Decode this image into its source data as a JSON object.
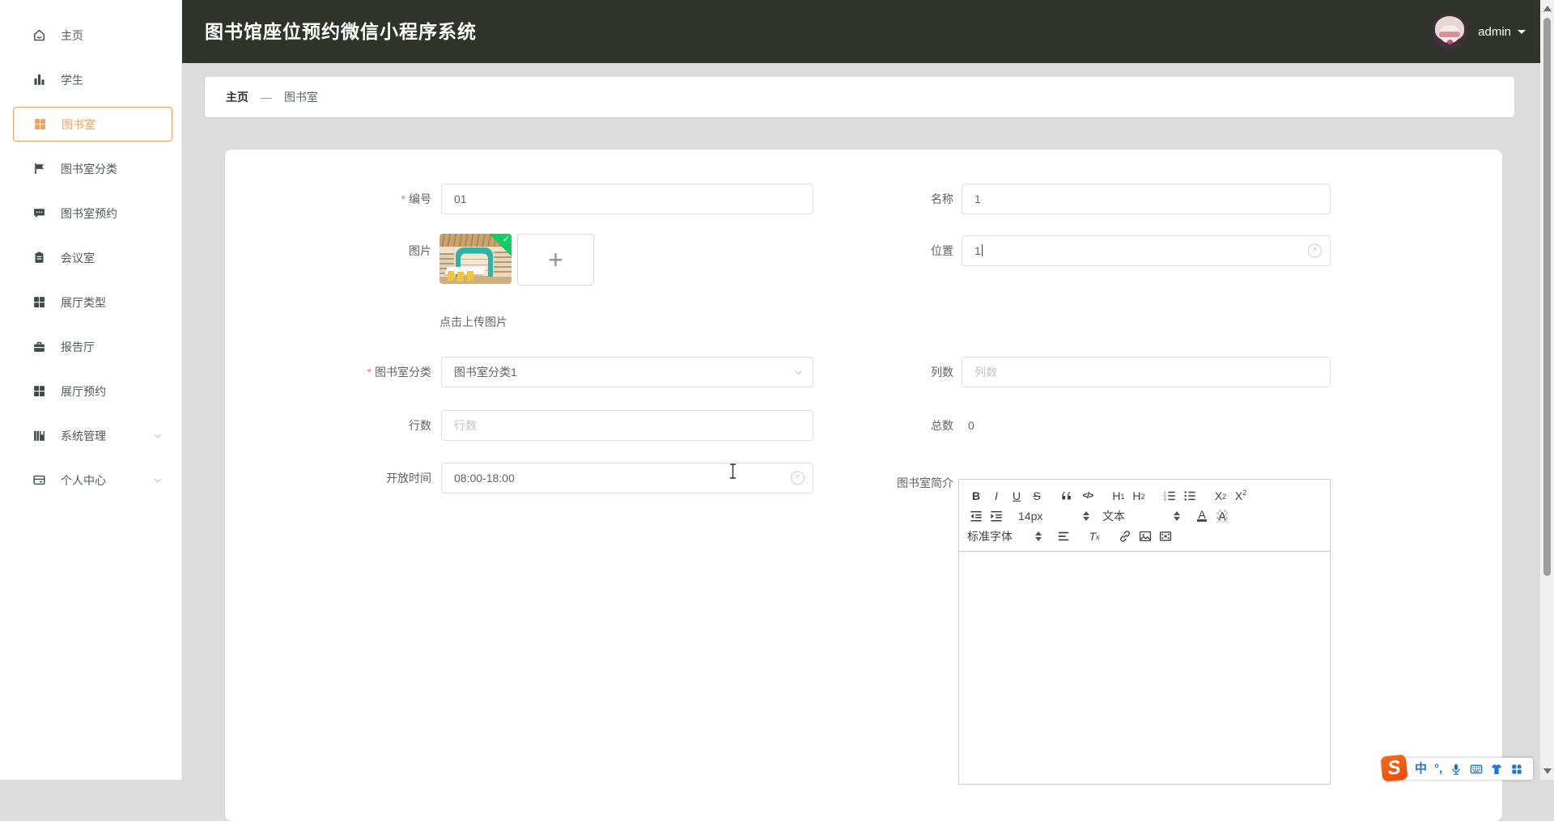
{
  "header": {
    "title": "图书馆座位预约微信小程序系统",
    "user_name": "admin"
  },
  "sidebar": {
    "items": [
      {
        "label": "主页",
        "icon": "home-icon"
      },
      {
        "label": "学生",
        "icon": "bar-chart-icon"
      },
      {
        "label": "图书室",
        "icon": "grid-icon",
        "active": true
      },
      {
        "label": "图书室分类",
        "icon": "flag-icon"
      },
      {
        "label": "图书室预约",
        "icon": "chat-icon"
      },
      {
        "label": "会议室",
        "icon": "clipboard-icon"
      },
      {
        "label": "展厅类型",
        "icon": "grid-icon"
      },
      {
        "label": "报告厅",
        "icon": "briefcase-icon"
      },
      {
        "label": "展厅预约",
        "icon": "grid-icon"
      },
      {
        "label": "系统管理",
        "icon": "books-icon",
        "expandable": true
      },
      {
        "label": "个人中心",
        "icon": "card-icon",
        "expandable": true
      }
    ]
  },
  "breadcrumb": {
    "home": "主页",
    "separator": "—",
    "current": "图书室"
  },
  "form": {
    "required_mark": "*",
    "code": {
      "label": "编号",
      "value": "01",
      "required": true
    },
    "name": {
      "label": "名称",
      "value": "1"
    },
    "image": {
      "label": "图片",
      "hint": "点击上传图片",
      "plus": "+"
    },
    "location": {
      "label": "位置",
      "value": "1"
    },
    "category": {
      "label": "图书室分类",
      "value": "图书室分类1",
      "required": true
    },
    "columns": {
      "label": "列数",
      "placeholder": "列数"
    },
    "rows": {
      "label": "行数",
      "placeholder": "行数"
    },
    "total": {
      "label": "总数",
      "value": "0"
    },
    "open_time": {
      "label": "开放时间",
      "value": "08:00-18:00"
    },
    "intro": {
      "label": "图书室简介"
    }
  },
  "editor": {
    "toolbar_rows": [
      [
        {
          "name": "bold",
          "main": "B",
          "bold": true
        },
        {
          "name": "italic",
          "main": "I",
          "italic": true
        },
        {
          "name": "underline",
          "main": "U",
          "underline": true
        },
        {
          "name": "strike",
          "main": "S",
          "strike": true,
          "gap": true
        },
        {
          "name": "blockquote",
          "icon": "blockquote-icon"
        },
        {
          "name": "code",
          "main": "</>",
          "code": true,
          "gap": true
        },
        {
          "name": "header-1",
          "main": "H",
          "sub": "1"
        },
        {
          "name": "header-2",
          "main": "H",
          "sub": "2",
          "gap": true
        },
        {
          "name": "ordered-list",
          "icon": "ordered-list-icon"
        },
        {
          "name": "bullet-list",
          "icon": "bullet-list-icon",
          "gap": true
        },
        {
          "name": "subscript",
          "main": "X",
          "sub": "2"
        },
        {
          "name": "superscript",
          "main": "X",
          "sup": "2"
        }
      ],
      [
        {
          "name": "outdent",
          "icon": "outdent-icon"
        },
        {
          "name": "indent",
          "icon": "indent-icon",
          "gap": true
        },
        {
          "name": "size-select",
          "select": "14px",
          "cls": "sel-size",
          "gap": true
        },
        {
          "name": "header-select",
          "select": "文本",
          "cls": "sel-head",
          "gap": true
        },
        {
          "name": "color",
          "main": "A",
          "underbar": true
        },
        {
          "name": "background",
          "main": "A",
          "hatch": true
        }
      ],
      [
        {
          "name": "font-select",
          "select": "标准字体",
          "cls": "sel-font",
          "gap": true
        },
        {
          "name": "align",
          "icon": "align-icon",
          "gap": true
        },
        {
          "name": "clean",
          "main": "T",
          "sub": "x",
          "italic": true,
          "gap": true
        },
        {
          "name": "link",
          "icon": "link-icon"
        },
        {
          "name": "image",
          "icon": "image-icon"
        },
        {
          "name": "video",
          "icon": "video-icon"
        }
      ]
    ]
  },
  "ime": {
    "logo": "S",
    "lang": "中",
    "punct": "°,"
  },
  "colors": {
    "accent": "#f0a05c",
    "header_bg": "#2f332c",
    "page_bg": "#dcdcdc",
    "success_green": "#13ce66",
    "ime_blue": "#2273d6",
    "required_red": "#f56c6c"
  }
}
